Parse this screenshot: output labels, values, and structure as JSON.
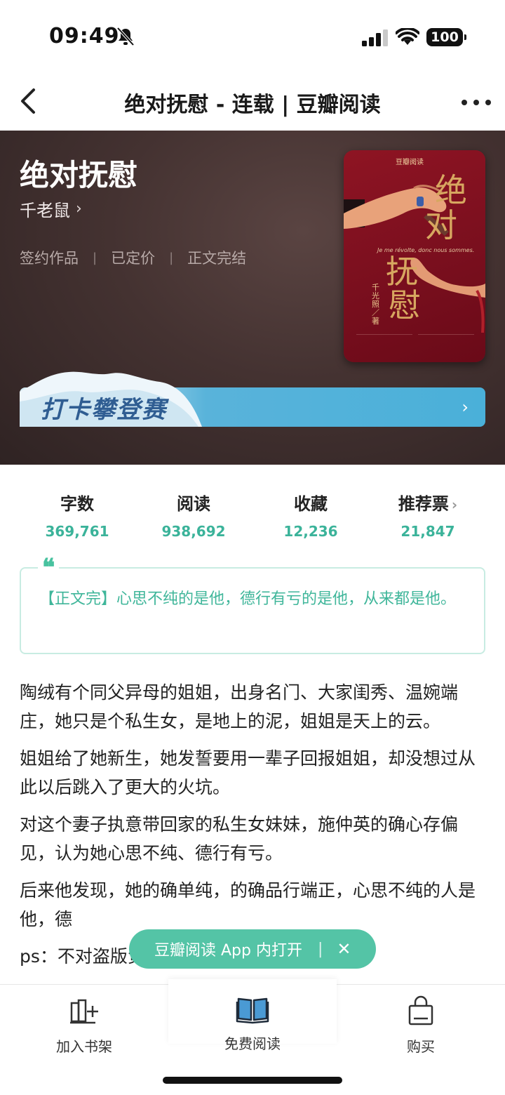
{
  "status_bar": {
    "time": "09:49",
    "battery": "100"
  },
  "nav": {
    "title": "绝对抚慰 - 连载 | 豆瓣阅读"
  },
  "book": {
    "title": "绝对抚慰",
    "author": "千老鼠",
    "tags": [
      "签约作品",
      "已定价",
      "正文完结"
    ],
    "tag_separator": "|"
  },
  "cover": {
    "logo": "豆瓣阅读",
    "big_chars": [
      "绝",
      "对",
      "抚",
      "慰"
    ],
    "subtitle": "Je me révolte, donc nous sommes.",
    "author_vertical": "千光照／著"
  },
  "banner": {
    "text": "打卡攀登赛",
    "arrow": "›"
  },
  "stats": [
    {
      "label": "字数",
      "value": "369,761"
    },
    {
      "label": "阅读",
      "value": "938,692"
    },
    {
      "label": "收藏",
      "value": "12,236"
    },
    {
      "label": "推荐票",
      "value": "21,847",
      "chevron": "›"
    }
  ],
  "quote": {
    "mark": "❝",
    "text": "【正文完】心思不纯的是他，德行有亏的是他，从来都是他。"
  },
  "description": [
    "陶绒有个同父异母的姐姐，出身名门、大家闺秀、温婉端庄，她只是个私生女，是地上的泥，姐姐是天上的云。",
    "姐姐给了她新生，她发誓要用一辈子回报姐姐，却没想过从此以后跳入了更大的火坑。",
    "对这个妻子执意带回家的私生女妹妹，施仲英的确心存偏见，认为她心思不纯、德行有亏。",
    "后来他发现，她的确单纯，的确品行端正，心思不纯的人是他，德",
    "ps：不对盗版负责。全修文，盗版看不到"
  ],
  "open_app": {
    "label": "豆瓣阅读 App 内打开",
    "separator": "|",
    "close": "✕"
  },
  "bottom_bar": {
    "add_shelf": "加入书架",
    "free_read": "免费阅读",
    "buy": "购买"
  },
  "colors": {
    "accent": "#3bb39a",
    "pill": "#54c4a6",
    "hero_bg": "#443231",
    "cover_red": "#7a0f1e"
  }
}
